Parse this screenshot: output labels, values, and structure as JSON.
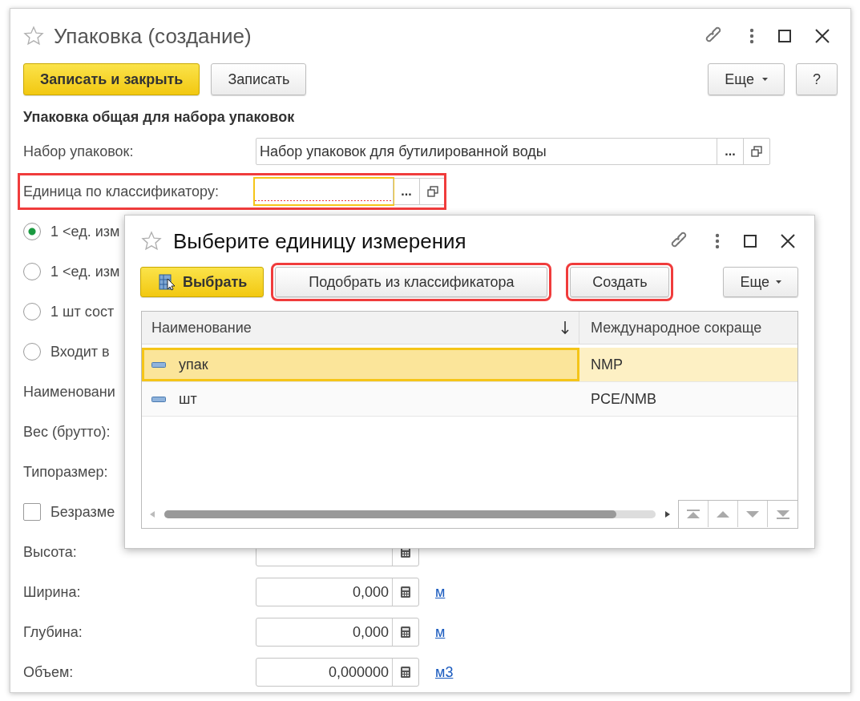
{
  "window": {
    "title": "Упаковка (создание)"
  },
  "toolbar": [
    {
      "label": "Записать и закрыть",
      "kind": "primary"
    },
    {
      "label": "Записать",
      "kind": "normal"
    },
    {
      "label": "Еще",
      "kind": "menu"
    },
    {
      "label": "?",
      "kind": "normal"
    }
  ],
  "section_title": "Упаковка общая для набора упаковок",
  "fields": [
    {
      "label": "Набор упаковок:",
      "value": "Набор упаковок для бутилированной воды",
      "action": "...",
      "focused": false,
      "required": false
    },
    {
      "label": "Единица по классификатору:",
      "action": "...",
      "highlighted": true,
      "focused": true,
      "required": true
    }
  ],
  "form_rows": [
    {
      "kind": "radio",
      "label": "1 <ед. изм",
      "selected": true
    },
    {
      "kind": "radio",
      "label": "1 <ед. изм",
      "selected": false
    },
    {
      "kind": "radio",
      "label": "1 шт сост",
      "selected": false
    },
    {
      "kind": "radio",
      "label": "Входит в",
      "selected": false
    },
    {
      "kind": "label",
      "label": "Наименовани"
    },
    {
      "kind": "label",
      "label": "Вес (брутто):"
    },
    {
      "kind": "label",
      "label": "Типоразмер:"
    },
    {
      "kind": "checkbox",
      "label": "Безразме",
      "checked": false
    },
    {
      "kind": "number",
      "label": "Высота:"
    },
    {
      "kind": "number",
      "label": "Ширина:",
      "value": "0,000",
      "unit": "м"
    },
    {
      "kind": "number",
      "label": "Глубина:",
      "value": "0,000",
      "unit": "м"
    },
    {
      "kind": "number",
      "label": "Объем:",
      "value": "0,000000",
      "unit": "м3"
    }
  ],
  "dialog": {
    "title": "Выберите единицу измерения",
    "buttons": [
      {
        "label": "Выбрать",
        "kind": "primary",
        "highlighted": false
      },
      {
        "label": "Подобрать из классификатора",
        "kind": "normal",
        "highlighted": true
      },
      {
        "label": "Создать",
        "kind": "normal",
        "highlighted": true
      },
      {
        "label": "Еще",
        "kind": "menu",
        "highlighted": false
      }
    ],
    "table": {
      "columns": [
        {
          "label": "Наименование",
          "sorted": true
        },
        {
          "label": "Международное сокраще",
          "sorted": false
        }
      ],
      "rows": [
        {
          "cells": [
            "упак",
            "NMP"
          ],
          "selected": true
        },
        {
          "cells": [
            "шт",
            "PCE/NMB"
          ],
          "selected": false
        }
      ]
    }
  }
}
